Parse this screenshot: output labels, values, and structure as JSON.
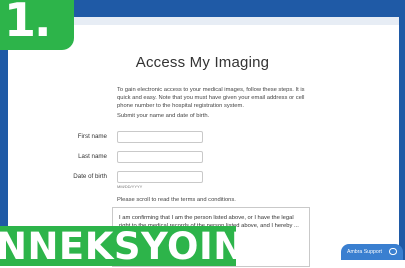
{
  "badge": {
    "text": "1."
  },
  "page": {
    "title": "Access My Imaging",
    "intro": "To gain electronic access to your medical images, follow these steps. It is quick and easy. Note that you must have given your email address or cell phone number to the hospital registration system.",
    "submit_note": "Submit your name and date of birth."
  },
  "form": {
    "first_name_label": "First name",
    "last_name_label": "Last name",
    "dob_label": "Date of birth",
    "first_name_value": "",
    "last_name_value": "",
    "dob_value": "",
    "dob_hint": "MM/DD/YYYY"
  },
  "terms": {
    "scroll_note": "Please scroll to read the terms and conditions.",
    "text": "I am confirming that I am the person listed above, or I have the legal right to the medical records of the person listed above, and I hereby ... studies available to me"
  },
  "banner": {
    "text": "NNEKSYOIN"
  },
  "support": {
    "label": "Ambra Support"
  },
  "colors": {
    "accent_green": "#2db44a",
    "frame_blue": "#1f5aa6",
    "support_blue": "#3a7fd0"
  }
}
